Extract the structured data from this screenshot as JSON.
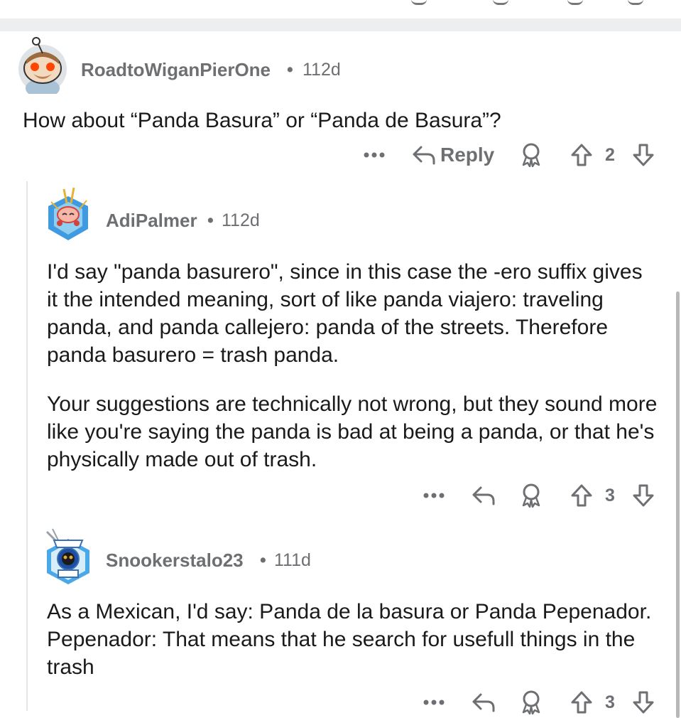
{
  "comments": [
    {
      "username": "RoadtoWiganPierOne",
      "separator": "•",
      "age": "112d",
      "paragraphs": [
        "How about “Panda Basura” or “Panda de Basura”?"
      ],
      "reply_label": "Reply",
      "score": "2",
      "more_icon": "ellipsis-icon",
      "reply_icon": "reply-arrow-icon",
      "award_icon": "award-ribbon-icon",
      "upvote_icon": "upvote-arrow-icon",
      "downvote_icon": "downvote-arrow-icon"
    },
    {
      "username": "AdiPalmer",
      "separator": "•",
      "age": "112d",
      "paragraphs": [
        "I'd say \"panda basurero\", since in this case the -ero suffix gives it the intended meaning, sort of like panda viajero: traveling panda, and panda callejero: panda of the streets. Therefore panda basurero = trash panda.",
        "Your suggestions are technically not wrong, but they sound more like you're saying the panda is bad at being a panda, or that he's physically made out of trash."
      ],
      "score": "3"
    },
    {
      "username": "Snookerstalo23",
      "separator": "•",
      "age": "111d",
      "paragraphs": [
        "As a Mexican, I'd say: Panda de la basura or Panda Pepenador. Pepenador: That means that he search for usefull things in the trash"
      ],
      "score": "3"
    }
  ],
  "colors": {
    "meta_gray": "#6d6f73",
    "text": "#1a1a1b",
    "divider": "#eceef0",
    "thread_line": "#e4e5e7"
  }
}
